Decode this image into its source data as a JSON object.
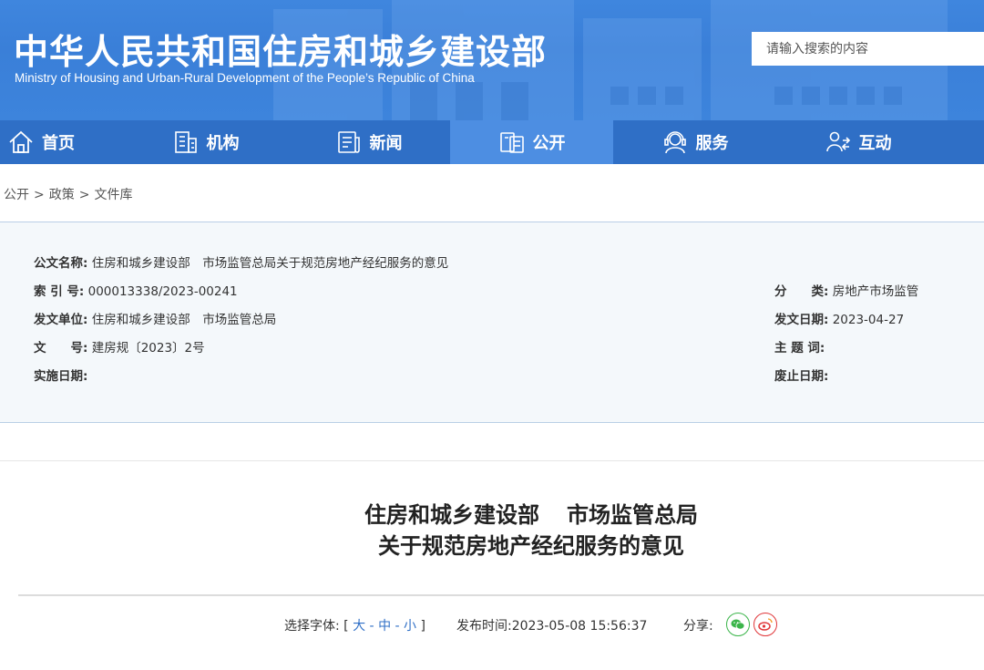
{
  "header": {
    "title": "中华人民共和国住房和城乡建设部",
    "subtitle": "Ministry of Housing and Urban-Rural Development of the People’s Republic of China",
    "search_placeholder": "请输入搜索的内容"
  },
  "nav": {
    "items": [
      {
        "label": "首页",
        "icon": "home-icon"
      },
      {
        "label": "机构",
        "icon": "building-icon"
      },
      {
        "label": "新闻",
        "icon": "newspaper-icon"
      },
      {
        "label": "公开",
        "icon": "document-icon"
      },
      {
        "label": "服务",
        "icon": "service-icon"
      },
      {
        "label": "互动",
        "icon": "interaction-icon"
      }
    ],
    "active_index": 3
  },
  "breadcrumb": {
    "items": [
      "公开",
      "政策",
      "文件库"
    ],
    "separator": ">"
  },
  "info": {
    "doc_name_key": "公文名称:",
    "doc_name_val": "住房和城乡建设部　市场监管总局关于规范房地产经纪服务的意见",
    "index_key": "索 引 号:",
    "index_val": "000013338/2023-00241",
    "category_key": "分　　类:",
    "category_val": "房地产市场监管",
    "issuer_key": "发文单位:",
    "issuer_val": "住房和城乡建设部　市场监管总局",
    "issue_date_key": "发文日期:",
    "issue_date_val": "2023-04-27",
    "doc_no_key": "文　　号:",
    "doc_no_val": "建房规〔2023〕2号",
    "keywords_key": "主 题 词:",
    "keywords_val": "",
    "effective_key": "实施日期:",
    "effective_val": "",
    "expiry_key": "废止日期:",
    "expiry_val": ""
  },
  "article": {
    "title_line1_a": "住房和城乡建设部",
    "title_line1_b": "市场监管总局",
    "title_line2": "关于规范房地产经纪服务的意见"
  },
  "meta": {
    "font_label": "选择字体:",
    "bracket_open": "[",
    "font_large": "大",
    "font_medium": "中",
    "font_small": "小",
    "dash": "-",
    "bracket_close": "]",
    "publish_label": "发布时间:",
    "publish_time": "2023-05-08 15:56:37",
    "share_label": "分享:"
  },
  "colors": {
    "banner": "#3d84dc",
    "nav": "#2f6fc6",
    "nav_active": "#4d8ee2",
    "info_bg": "#f4f8fb",
    "wechat": "#3bb54a",
    "weibo": "#e0373a"
  }
}
